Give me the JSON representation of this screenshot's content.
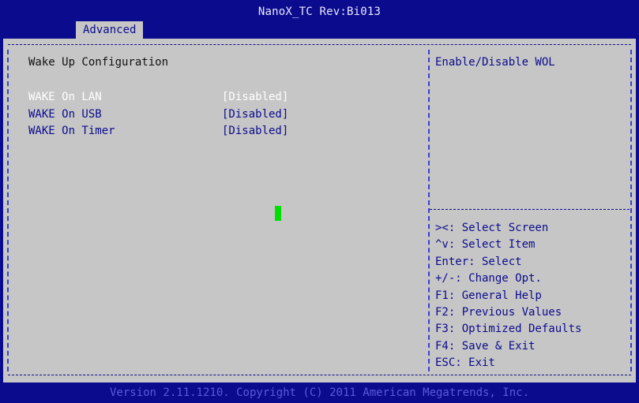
{
  "header": {
    "title": "NanoX_TC Rev:Bi013",
    "tabs": [
      {
        "label": "Advanced",
        "active": true
      }
    ]
  },
  "main": {
    "section_title": "Wake Up Configuration",
    "items": [
      {
        "label": "WAKE On LAN",
        "value": "[Disabled]",
        "selected": true
      },
      {
        "label": "WAKE On USB",
        "value": "[Disabled]",
        "selected": false
      },
      {
        "label": "WAKE On Timer",
        "value": "[Disabled]",
        "selected": false
      }
    ]
  },
  "help": {
    "description": "Enable/Disable WOL",
    "keys": [
      "><: Select Screen",
      "^v: Select Item",
      "Enter: Select",
      "+/-: Change Opt.",
      "F1: General Help",
      "F2: Previous Values",
      "F3: Optimized Defaults",
      "F4: Save & Exit",
      "ESC: Exit"
    ]
  },
  "footer": {
    "text": "Version 2.11.1210. Copyright (C) 2011 American Megatrends, Inc."
  },
  "colors": {
    "background": "#0b0b8e",
    "panel": "#c6c6c6",
    "text_blue": "#0b0b8e",
    "selected_text": "#ffffff",
    "cursor": "#00e000"
  }
}
